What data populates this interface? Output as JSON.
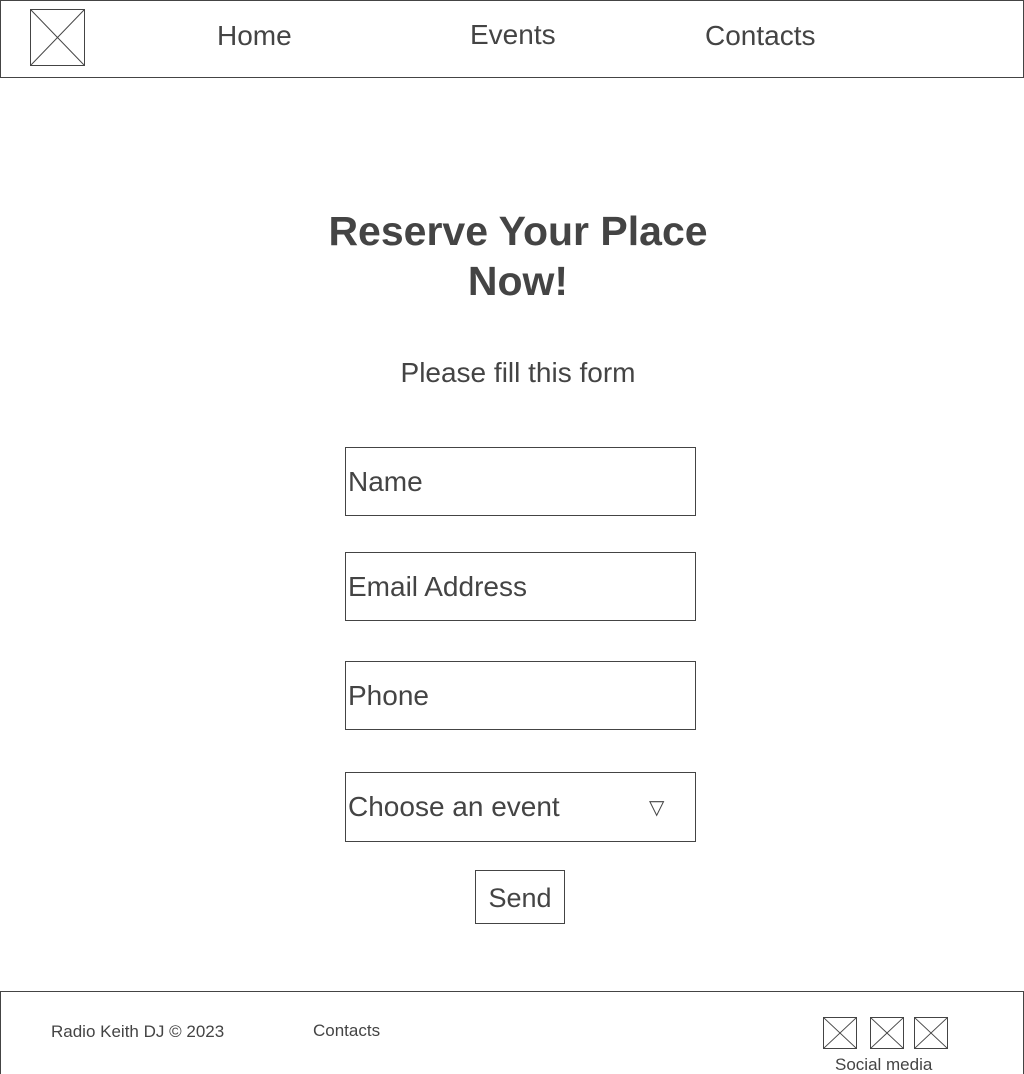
{
  "header": {
    "logo_icon": "image-placeholder-icon",
    "nav": {
      "home": "Home",
      "events": "Events",
      "contacts": "Contacts"
    }
  },
  "main": {
    "title_line1": "Reserve Your Place",
    "title_line2": "Now!",
    "subtitle": "Please fill this form"
  },
  "form": {
    "name_placeholder": "Name",
    "email_placeholder": "Email Address",
    "phone_placeholder": "Phone",
    "event_select": {
      "selected": "Choose an event",
      "arrow_icon": "▽"
    },
    "send_label": "Send"
  },
  "footer": {
    "copyright": "Radio Keith DJ © 2023",
    "contacts_link": "Contacts",
    "social_label": "Social media",
    "social_icons": [
      "image-placeholder-icon",
      "image-placeholder-icon",
      "image-placeholder-icon"
    ]
  }
}
